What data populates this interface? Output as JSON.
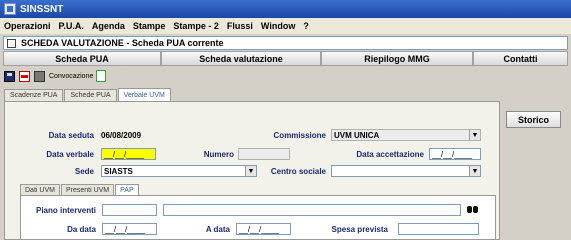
{
  "window": {
    "title": "SINSSNT"
  },
  "menu": [
    "Operazioni",
    "P.U.A.",
    "Agenda",
    "Stampe",
    "Stampe - 2",
    "Flussi",
    "Window",
    "?"
  ],
  "panel": {
    "title": "SCHEDA VALUTAZIONE - Scheda PUA corrente"
  },
  "nav": [
    "Scheda PUA",
    "Scheda valutazione",
    "Riepilogo MMG",
    "Contatti"
  ],
  "toolbar": {
    "convocazione_label": "Convocazione"
  },
  "tabs": [
    "Scadenze PUA",
    "Schede PUA",
    "Verbale UVM"
  ],
  "active_tab": "Verbale UVM",
  "form": {
    "data_seduta_label": "Data seduta",
    "data_seduta_value": "06/08/2009",
    "commissione_label": "Commissione",
    "commissione_value": "UVM UNICA",
    "data_verbale_label": "Data verbale",
    "data_verbale_value": "__/__/____",
    "numero_label": "Numero",
    "numero_value": "",
    "data_accettazione_label": "Data accettazione",
    "data_accettazione_value": "__/__/____",
    "sede_label": "Sede",
    "sede_value": "SIASTS",
    "centro_sociale_label": "Centro sociale",
    "centro_sociale_value": ""
  },
  "storico_label": "Storico",
  "subtabs": [
    "Dati UVM",
    "Presenti UVM",
    "PAP"
  ],
  "active_subtab": "PAP",
  "pap": {
    "piano_interventi_label": "Piano interventi",
    "piano_interventi_code": "",
    "piano_interventi_desc": "",
    "da_data_label": "Da data",
    "da_data_value": "__/__/____",
    "a_data_label": "A data",
    "a_data_value": "__/__/____",
    "spesa_prevista_label": "Spesa prevista",
    "spesa_prevista_value": ""
  }
}
